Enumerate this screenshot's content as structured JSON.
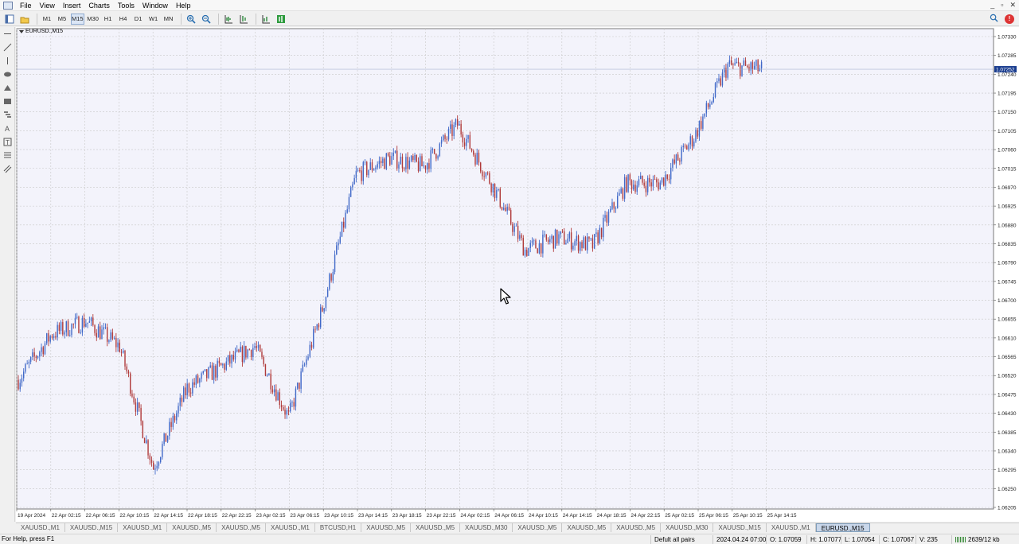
{
  "menu": {
    "items": [
      "File",
      "View",
      "Insert",
      "Charts",
      "Tools",
      "Window",
      "Help"
    ],
    "window_controls": [
      "_",
      "▫",
      "✕"
    ]
  },
  "toolbar": {
    "timeframes": [
      "M1",
      "M5",
      "M15",
      "M30",
      "H1",
      "H4",
      "D1",
      "W1",
      "MN"
    ],
    "active_timeframe": "M15"
  },
  "chart": {
    "title": "EURUSD.,M15",
    "current_price": "1.07252",
    "y_labels": [
      "1.07330",
      "1.07285",
      "1.07240",
      "1.07195",
      "1.07150",
      "1.07105",
      "1.07060",
      "1.07015",
      "1.06970",
      "1.06925",
      "1.06880",
      "1.06835",
      "1.06790",
      "1.06745",
      "1.06700",
      "1.06655",
      "1.06610",
      "1.06565",
      "1.06520",
      "1.06475",
      "1.06430",
      "1.06385",
      "1.06340",
      "1.06295",
      "1.06250",
      "1.06205"
    ],
    "x_labels": [
      "19 Apr 2024",
      "22 Apr 02:15",
      "22 Apr 06:15",
      "22 Apr 10:15",
      "22 Apr 14:15",
      "22 Apr 18:15",
      "22 Apr 22:15",
      "23 Apr 02:15",
      "23 Apr 06:15",
      "23 Apr 10:15",
      "23 Apr 14:15",
      "23 Apr 18:15",
      "23 Apr 22:15",
      "24 Apr 02:15",
      "24 Apr 06:15",
      "24 Apr 10:15",
      "24 Apr 14:15",
      "24 Apr 18:15",
      "24 Apr 22:15",
      "25 Apr 02:15",
      "25 Apr 06:15",
      "25 Apr 10:15",
      "25 Apr 14:15"
    ],
    "colors": {
      "bull": "#4169c8",
      "bear": "#b03a3a",
      "grid": "#c8c8c8",
      "price_tag": "#1a3d8f"
    }
  },
  "chart_data": {
    "type": "line",
    "ylim": [
      1.06205,
      1.0733
    ],
    "x": [
      "19 Apr 2024",
      "22 Apr 02:15",
      "22 Apr 06:15",
      "22 Apr 10:15",
      "22 Apr 14:15",
      "22 Apr 18:15",
      "22 Apr 22:15",
      "23 Apr 02:15",
      "23 Apr 06:15",
      "23 Apr 10:15",
      "23 Apr 14:15",
      "23 Apr 18:15",
      "23 Apr 22:15",
      "24 Apr 02:15",
      "24 Apr 06:15",
      "24 Apr 10:15",
      "24 Apr 14:15",
      "24 Apr 18:15",
      "24 Apr 22:15",
      "25 Apr 02:15",
      "25 Apr 06:15",
      "25 Apr 10:15",
      "25 Apr 14:15"
    ],
    "series": [
      {
        "values": [
          1.0651,
          1.0662,
          1.0665,
          1.0659,
          1.063,
          1.0649,
          1.0654,
          1.0659,
          1.0642,
          1.0668,
          1.07,
          1.0704,
          1.0702,
          1.0712,
          1.0698,
          1.0682,
          1.0685,
          1.0683,
          1.0698,
          1.0698,
          1.0709,
          1.0726,
          1.07252
        ]
      }
    ]
  },
  "tabs": {
    "items": [
      "XAUUSD.,M1",
      "XAUUSD.,M15",
      "XAUUSD.,M1",
      "XAUUSD.,M5",
      "XAUUSD.,M5",
      "XAUUSD.,M1",
      "BTCUSD,H1",
      "XAUUSD.,M5",
      "XAUUSD.,M5",
      "XAUUSD.,M30",
      "XAUUSD.,M5",
      "XAUUSD.,M5",
      "XAUUSD.,M5",
      "XAUUSD.,M30",
      "XAUUSD.,M15",
      "XAUUSD.,M1",
      "EURUSD.,M15"
    ],
    "active_index": 16
  },
  "status": {
    "help": "For Help, press F1",
    "profile": "Defult all pairs",
    "datetime": "2024.04.24 07:00",
    "open": "O: 1.07059",
    "high": "H: 1.07077",
    "low": "L: 1.07054",
    "close": "C: 1.07067",
    "volume": "V: 235",
    "traffic": "2639/12 kb"
  }
}
